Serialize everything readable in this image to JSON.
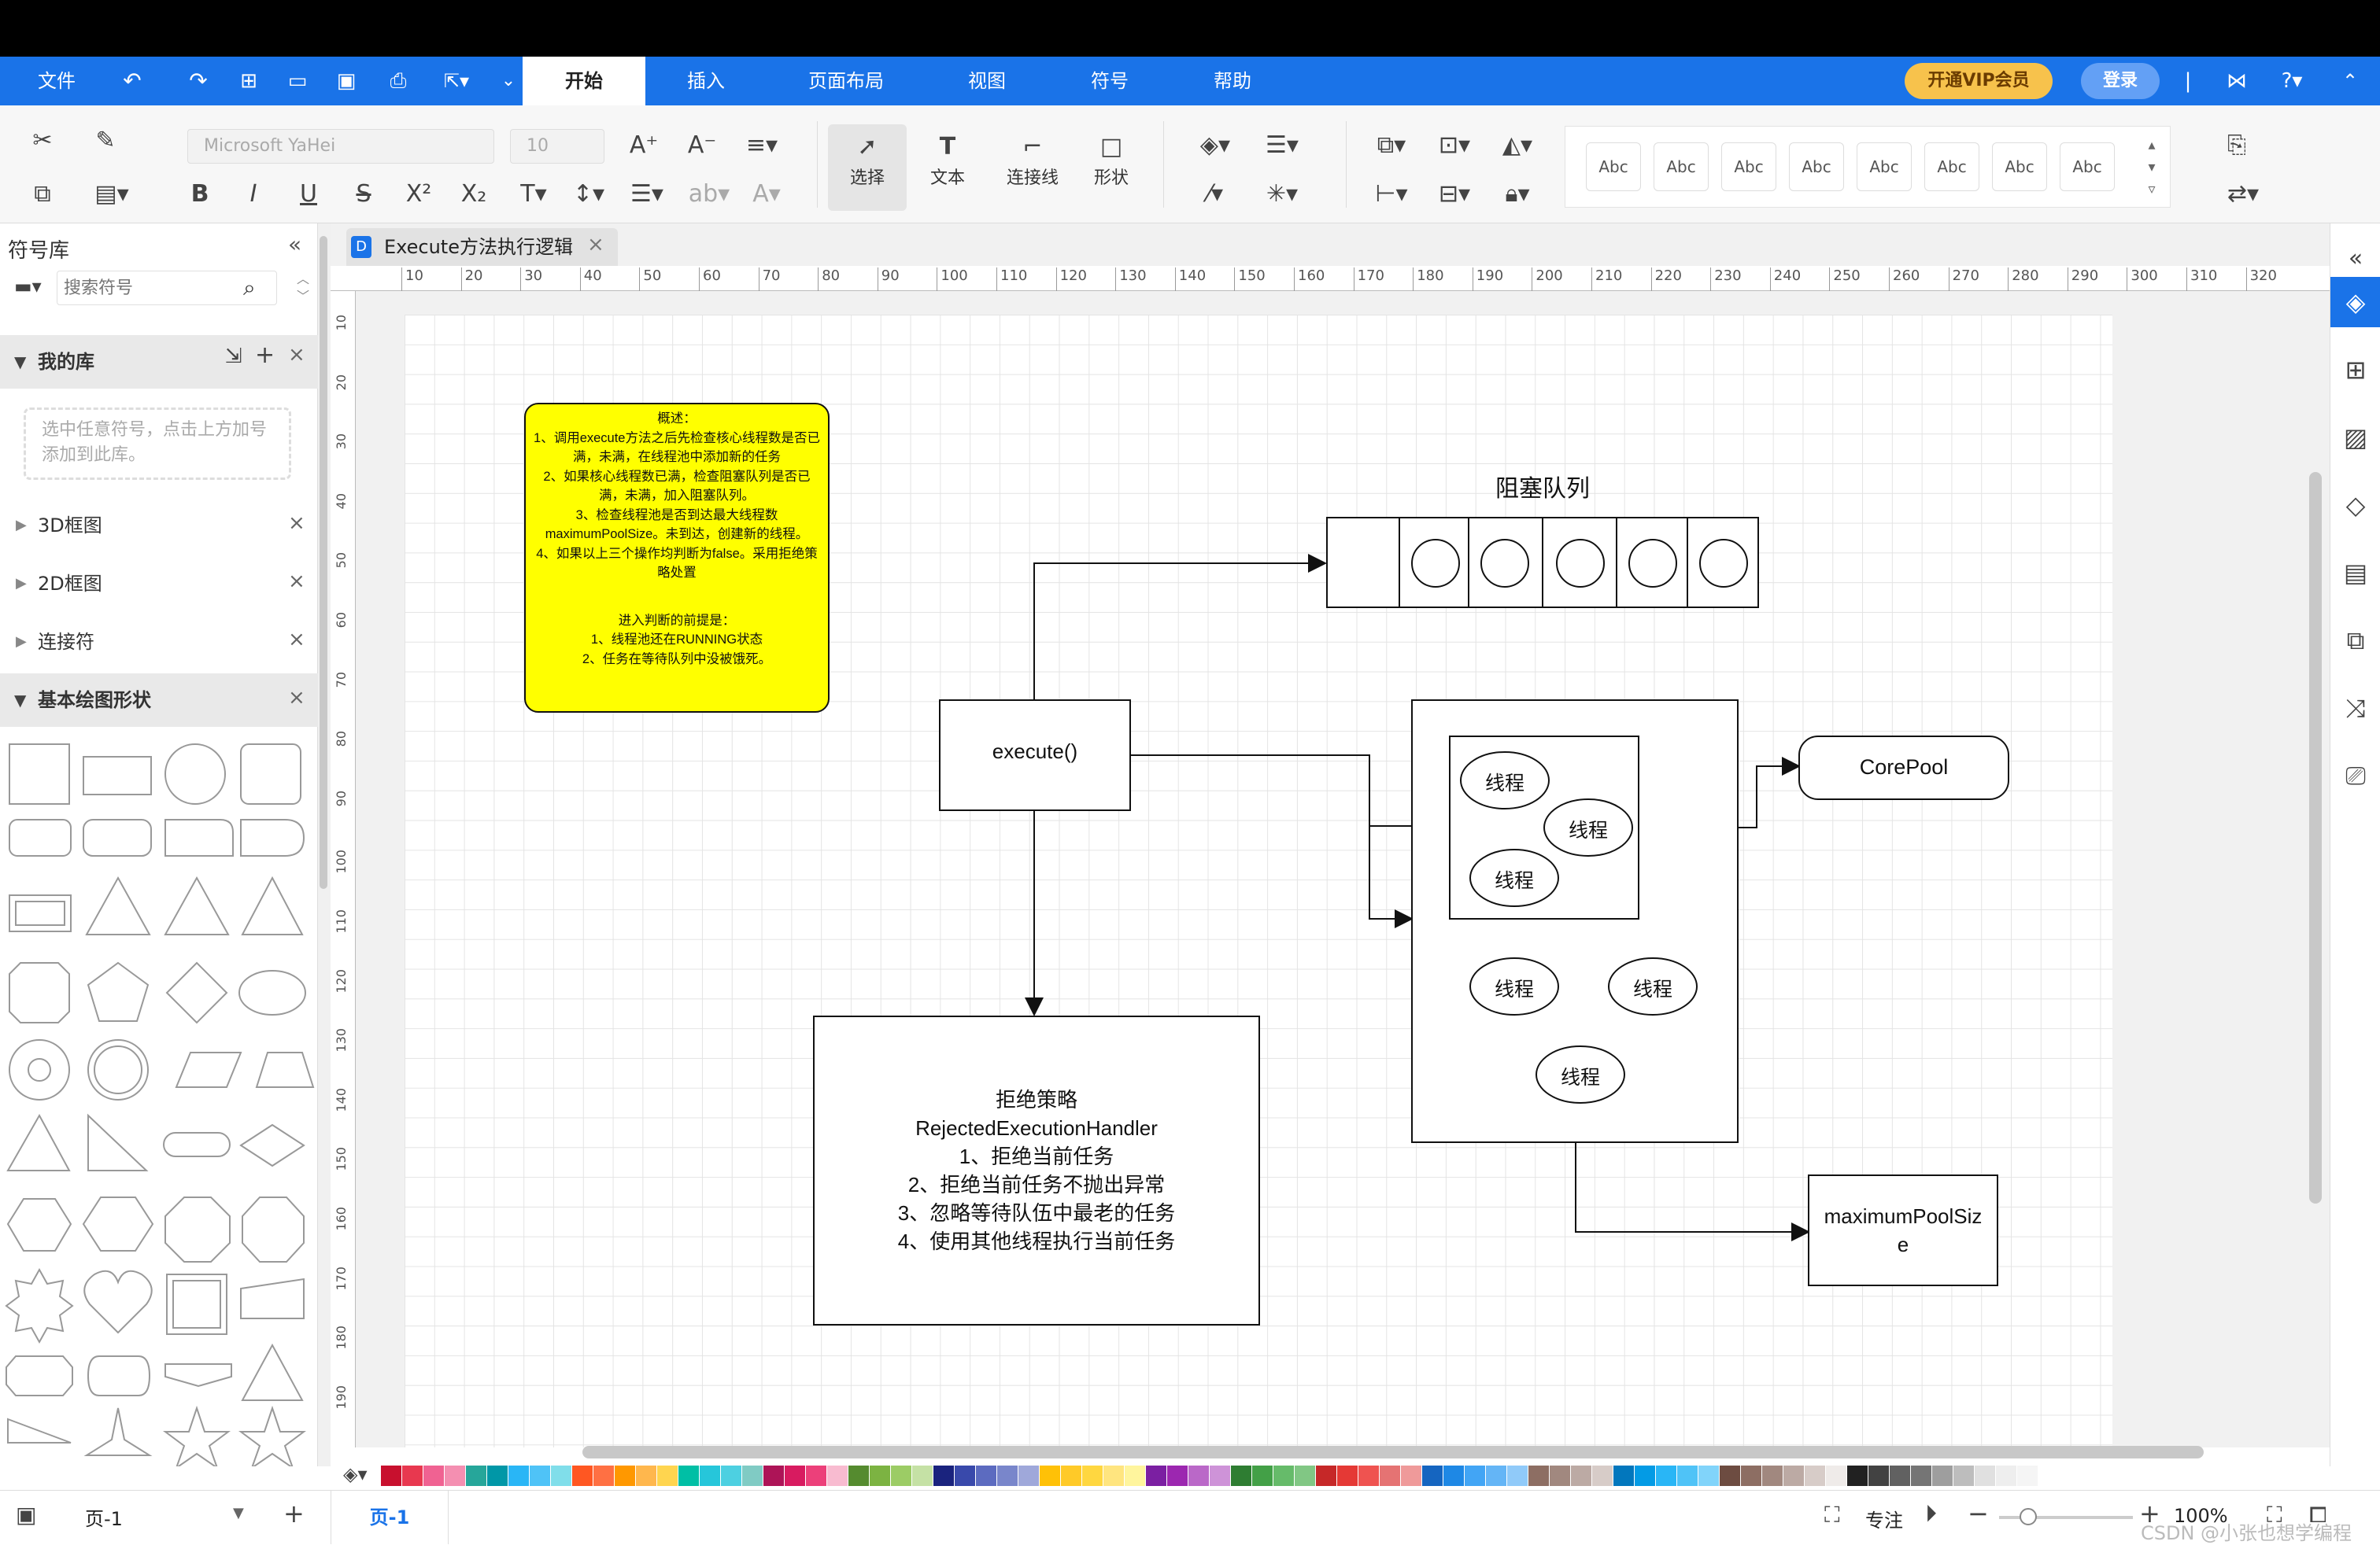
{
  "menu": {
    "file": "文件",
    "tabs": [
      "开始",
      "插入",
      "页面布局",
      "视图",
      "符号",
      "帮助"
    ],
    "vip": "开通VIP会员",
    "login": "登录"
  },
  "toolbar": {
    "font_name": "Microsoft YaHei",
    "font_size": "10",
    "tools": [
      "选择",
      "文本",
      "连接线",
      "形状"
    ],
    "style_label": "Abc"
  },
  "left_panel": {
    "title": "符号库",
    "search_placeholder": "搜索符号",
    "my_library": "我的库",
    "my_library_hint": "选中任意符号，点击上方加号添加到此库。",
    "sections": [
      "3D框图",
      "2D框图",
      "连接符",
      "基本绘图形状"
    ]
  },
  "document": {
    "tab_title": "Execute方法执行逻辑"
  },
  "ruler": {
    "h": [
      "10",
      "20",
      "30",
      "40",
      "50",
      "60",
      "70",
      "80",
      "90",
      "100",
      "110",
      "120",
      "130",
      "140",
      "150",
      "160",
      "170",
      "180",
      "190",
      "200",
      "210",
      "220",
      "230",
      "240",
      "250",
      "260",
      "270",
      "280",
      "290",
      "300",
      "310",
      "320"
    ],
    "v": [
      "10",
      "20",
      "30",
      "40",
      "50",
      "60",
      "70",
      "80",
      "90",
      "100",
      "110",
      "120",
      "130",
      "140",
      "150",
      "160",
      "170",
      "180",
      "190"
    ]
  },
  "diagram": {
    "note_lines": [
      "概述：",
      "1、调用execute方法之后先检查核心线程数是否已满，未满，在线程池中添加新的任务",
      "2、如果核心线程数已满，检查阻塞队列是否已满，未满，加入阻塞队列。",
      "3、检查线程池是否到达最大线程数maximumPoolSize。未到达，创建新的线程。",
      "4、如果以上三个操作均判断为false。采用拒绝策略处置",
      "",
      "进入判断的前提是：",
      "1、线程池还在RUNNING状态",
      "2、任务在等待队列中没被饿死。"
    ],
    "queue_title": "阻塞队列",
    "execute": "execute()",
    "thread": "线程",
    "corepool": "CorePool",
    "maxpool_line1": "maximumPoolSiz",
    "maxpool_line2": "e",
    "reject_lines": [
      "拒绝策略",
      "RejectedExecutionHandler",
      "1、拒绝当前任务",
      "2、拒绝当前任务不抛出异常",
      "3、忽略等待队伍中最老的任务",
      "4、使用其他线程执行当前任务"
    ]
  },
  "status": {
    "page_select": "页-1",
    "page_tab": "页-1",
    "focus": "专注",
    "zoom": "100%",
    "watermark": "CSDN @小张也想学编程"
  },
  "colors": {
    "accent": "#1a73e8",
    "note_fill": "#ffff00",
    "vip": "#f7c24c"
  }
}
